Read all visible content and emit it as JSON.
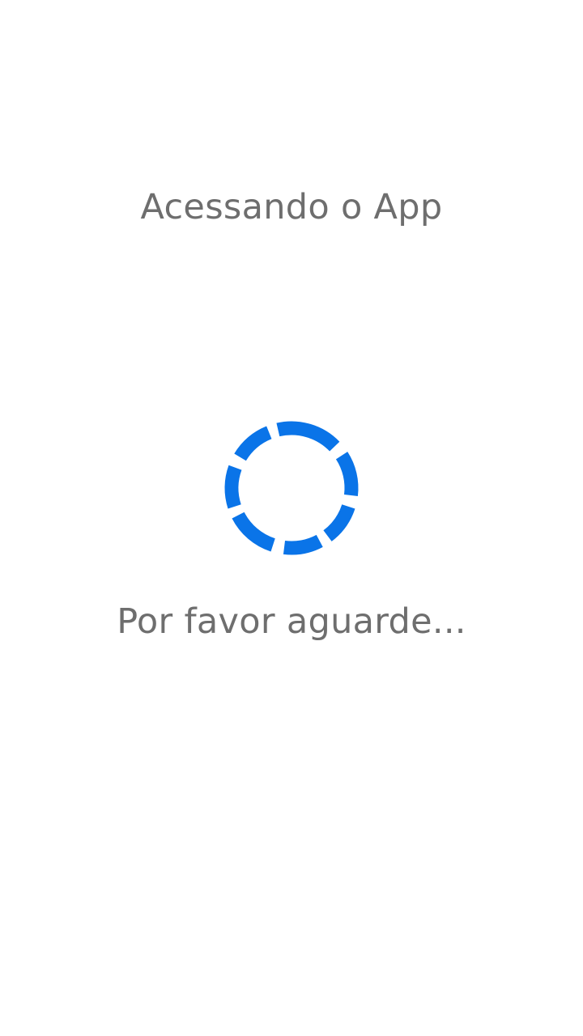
{
  "screen": {
    "title": "Acessando o App",
    "subtitle": "Por favor aguarde..."
  },
  "spinner": {
    "icon": "loading-spinner-icon",
    "color": "#0a74e8"
  },
  "colors": {
    "background": "#ffffff",
    "text": "#6e6e6e"
  }
}
